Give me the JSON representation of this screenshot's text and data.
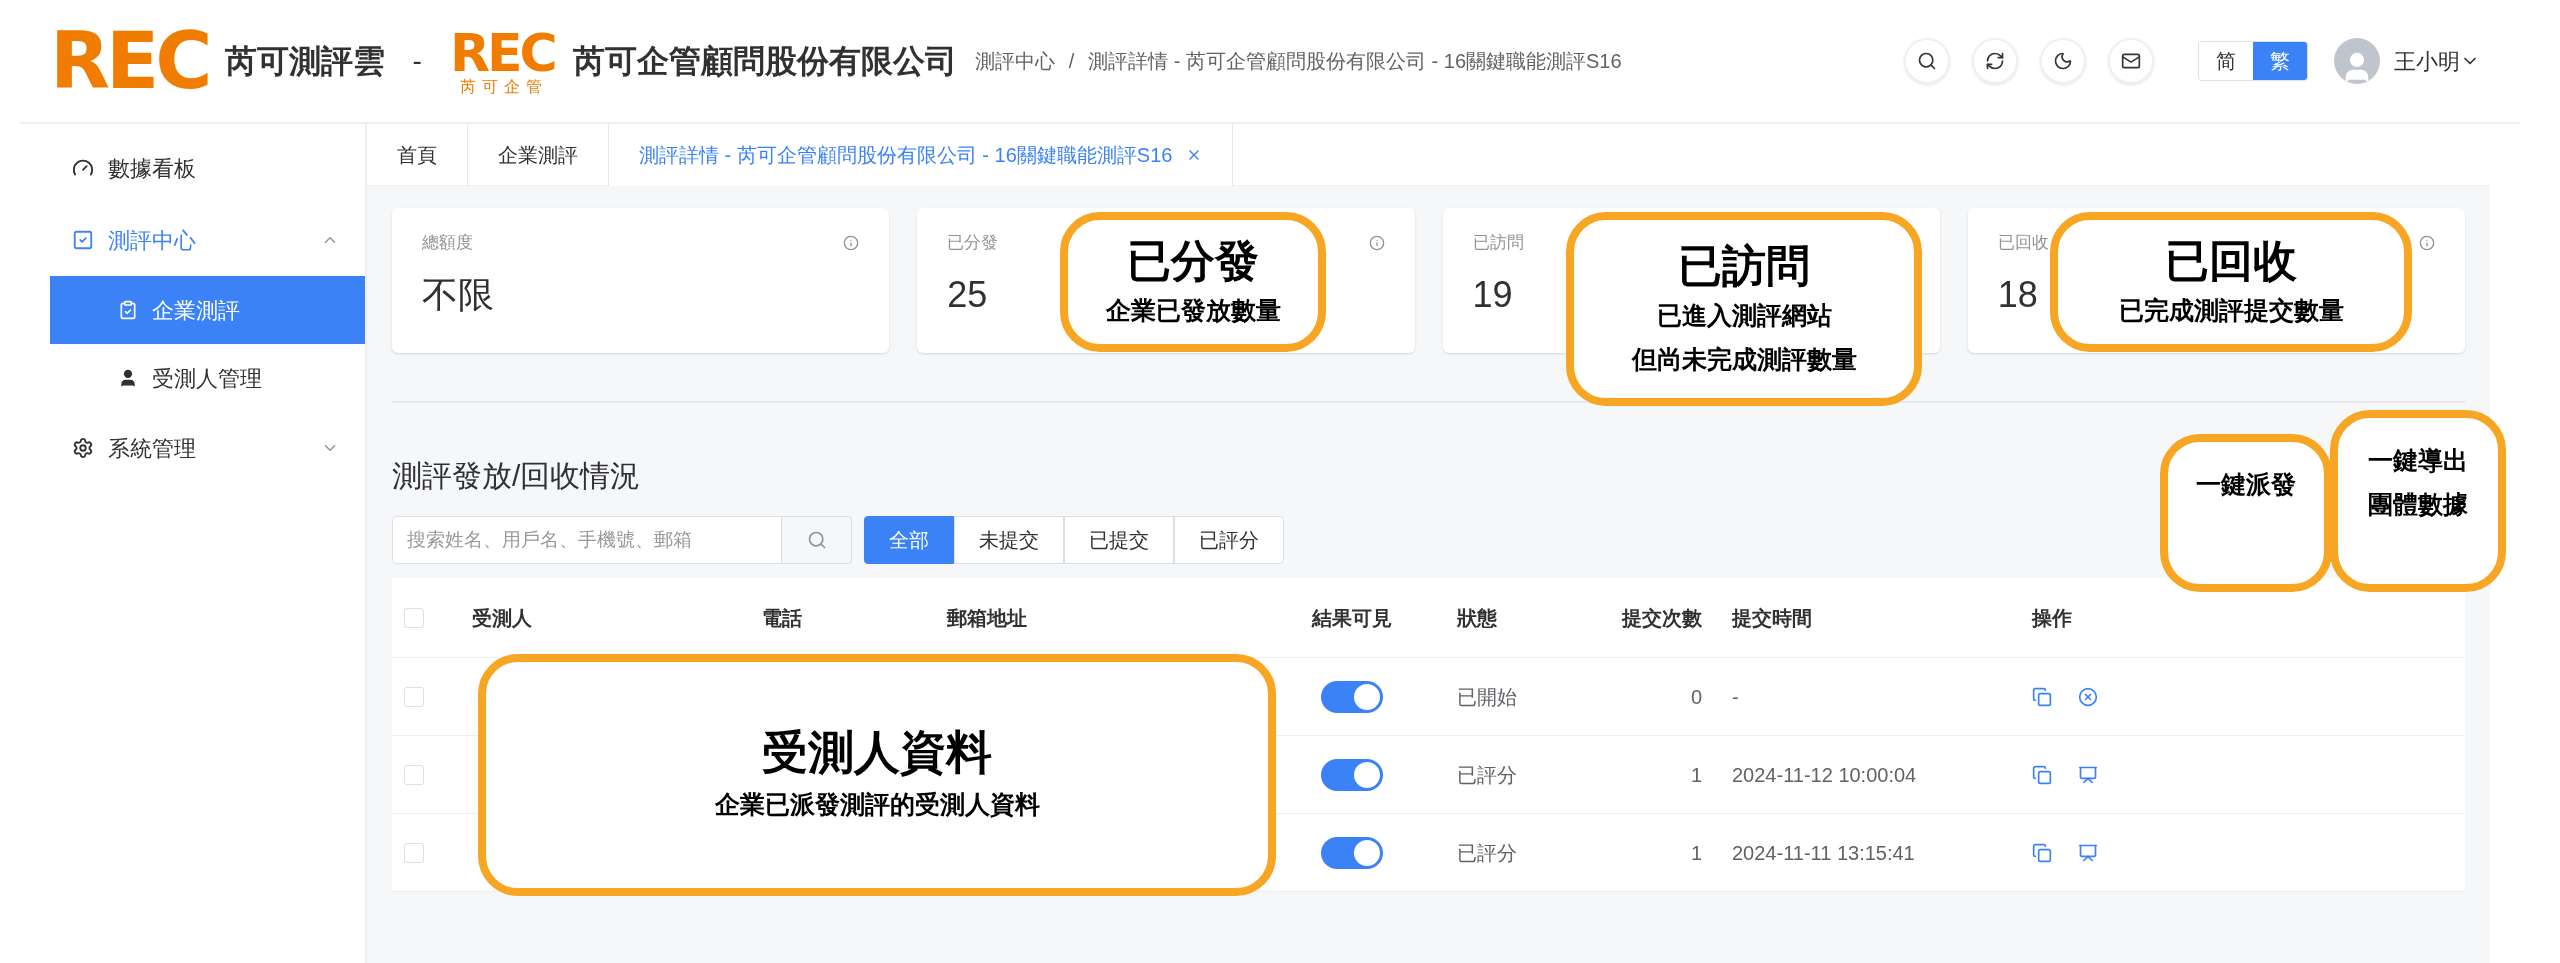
{
  "header": {
    "logo": "REC",
    "brand": "芮可測評雲",
    "separator": "-",
    "company_logo": "REC",
    "company_logo_sub": "芮可企管",
    "company": "芮可企管顧問股份有限公司",
    "breadcrumbs": [
      "測評中心",
      "測評詳情 - 芮可企管顧問股份有限公司 - 16關鍵職能測評S16"
    ],
    "breadcrumb_separator": "/",
    "languages": [
      {
        "label": "简",
        "selected": false
      },
      {
        "label": "繁",
        "selected": true
      }
    ],
    "user": "王小明"
  },
  "sidebar": {
    "items": [
      {
        "label": "數據看板",
        "selected": false
      },
      {
        "label": "測評中心",
        "selected": false,
        "expanded": true,
        "children": [
          {
            "label": "企業測評",
            "selected": true
          },
          {
            "label": "受測人管理",
            "selected": false
          }
        ]
      },
      {
        "label": "系統管理",
        "selected": false,
        "expanded": false
      }
    ]
  },
  "tabs": [
    {
      "label": "首頁",
      "selected": false,
      "closable": false
    },
    {
      "label": "企業測評",
      "selected": false,
      "closable": false
    },
    {
      "label": "測評詳情 - 芮可企管顧問股份有限公司 - 16關鍵職能測評S16",
      "selected": true,
      "closable": true
    }
  ],
  "stats": [
    {
      "label": "總額度",
      "value": "不限"
    },
    {
      "label": "已分發",
      "value": "25"
    },
    {
      "label": "已訪問",
      "value": "19"
    },
    {
      "label": "已回收",
      "value": "18"
    }
  ],
  "section_title": "測評發放/回收情況",
  "search": {
    "placeholder": "搜索姓名、用戶名、手機號、郵箱"
  },
  "filters": [
    {
      "label": "全部",
      "selected": true
    },
    {
      "label": "未提交",
      "selected": false
    },
    {
      "label": "已提交",
      "selected": false
    },
    {
      "label": "已評分",
      "selected": false
    }
  ],
  "table": {
    "select_all_checked": false,
    "columns": [
      "受測人",
      "電話",
      "郵箱地址",
      "結果可見",
      "狀態",
      "提交次數",
      "提交時間",
      "操作"
    ],
    "rows": [
      {
        "checked": false,
        "result_visible": true,
        "status": "已開始",
        "count": "0",
        "time": "-",
        "kind": "cancelable"
      },
      {
        "checked": false,
        "result_visible": true,
        "status": "已評分",
        "count": "1",
        "time": "2024-11-12 10:00:04",
        "kind": "reportable"
      },
      {
        "checked": false,
        "result_visible": true,
        "status": "已評分",
        "count": "1",
        "time": "2024-11-11 13:15:41",
        "kind": "reportable"
      }
    ]
  },
  "annotations": [
    {
      "title": "已分發",
      "lines": [
        "企業已發放數量"
      ]
    },
    {
      "title": "已訪問",
      "lines": [
        "已進入測評網站",
        "但尚未完成測評數量"
      ]
    },
    {
      "title": "已回收",
      "lines": [
        "已完成測評提交數量"
      ]
    },
    {
      "lines": [
        "一鍵派發"
      ]
    },
    {
      "lines": [
        "一鍵導出",
        "團體數據"
      ]
    },
    {
      "title": "受測人資料",
      "lines": [
        "企業已派發測評的受測人資料"
      ]
    }
  ]
}
